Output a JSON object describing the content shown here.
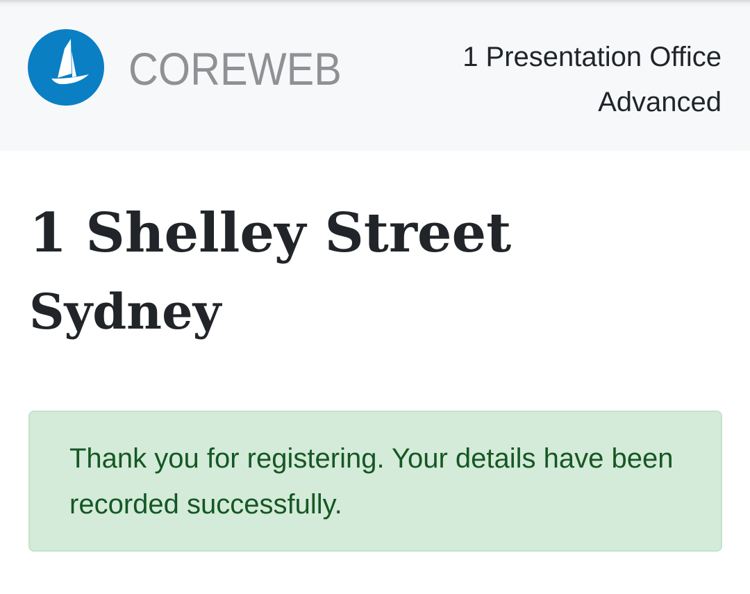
{
  "header": {
    "brand": "COREWEB",
    "logo_icon": "sail-boat-logo-icon",
    "accent_color": "#0a7fc4",
    "title_line1": "1 Presentation Office",
    "title_line2": "Advanced"
  },
  "location": {
    "street": "1 Shelley Street",
    "city": "Sydney"
  },
  "alert": {
    "type": "success",
    "message": "Thank you for registering. Your details have been recorded successfully.",
    "background_color": "#d4ebd9",
    "text_color": "#155724"
  }
}
